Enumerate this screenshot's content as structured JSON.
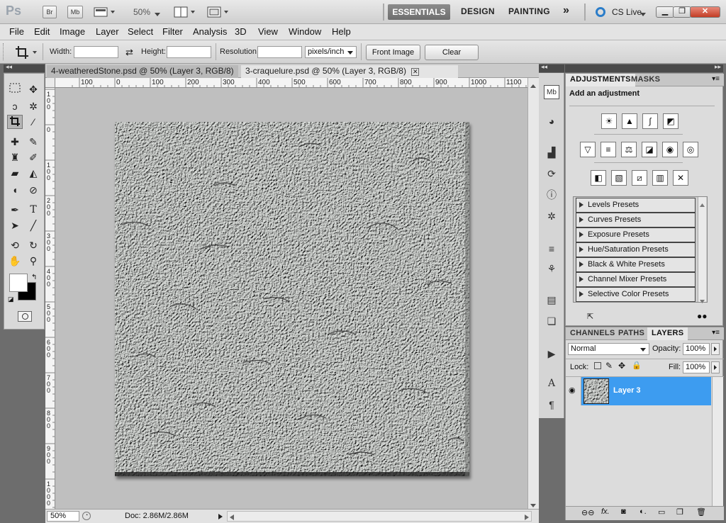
{
  "app": {
    "logo": "Ps",
    "zoom": "50%",
    "workspaces": [
      "ESSENTIALS",
      "DESIGN",
      "PAINTING"
    ],
    "more": "»",
    "cslive": "CS Live",
    "bridge_btn": "Br",
    "minibridge_btn": "Mb"
  },
  "menu": [
    "File",
    "Edit",
    "Image",
    "Layer",
    "Select",
    "Filter",
    "Analysis",
    "3D",
    "View",
    "Window",
    "Help"
  ],
  "options": {
    "width_label": "Width:",
    "width_value": "",
    "height_label": "Height:",
    "height_value": "",
    "resolution_label": "Resolution:",
    "resolution_value": "",
    "unit": "pixels/inch",
    "front_image": "Front Image",
    "clear": "Clear"
  },
  "tabs": [
    {
      "label": "4-weatheredStone.psd @ 50% (Layer 3, RGB/8)",
      "active": false
    },
    {
      "label": "3-craquelure.psd @ 50% (Layer 3, RGB/8)",
      "active": true
    }
  ],
  "ruler": {
    "h_ticks": [
      "100",
      "0",
      "100",
      "200",
      "300",
      "400",
      "500",
      "600",
      "700",
      "800",
      "900",
      "1000",
      "1100"
    ],
    "v_ticks": [
      "1 0 0",
      "0",
      "1 0 0",
      "2 0 0",
      "3 0 0",
      "4 0 0",
      "5 0 0",
      "6 0 0",
      "7 0 0",
      "8 0 0",
      "9 0 0",
      "1 0 0 0"
    ]
  },
  "status": {
    "zoom": "50%",
    "doc": "Doc: 2.86M/2.86M"
  },
  "adjustments": {
    "tab1": "ADJUSTMENTS",
    "tab2": "MASKS",
    "heading": "Add an adjustment",
    "presets": [
      "Levels Presets",
      "Curves Presets",
      "Exposure Presets",
      "Hue/Saturation Presets",
      "Black & White Presets",
      "Channel Mixer Presets",
      "Selective Color Presets"
    ]
  },
  "layers": {
    "tabs": [
      "CHANNELS",
      "PATHS",
      "LAYERS"
    ],
    "blend": "Normal",
    "opacity_label": "Opacity:",
    "opacity": "100%",
    "lock_label": "Lock:",
    "fill_label": "Fill:",
    "fill": "100%",
    "layer_name": "Layer 3"
  },
  "colors": {
    "accent": "#3d9cf0",
    "stone": "#c9ccc8"
  }
}
